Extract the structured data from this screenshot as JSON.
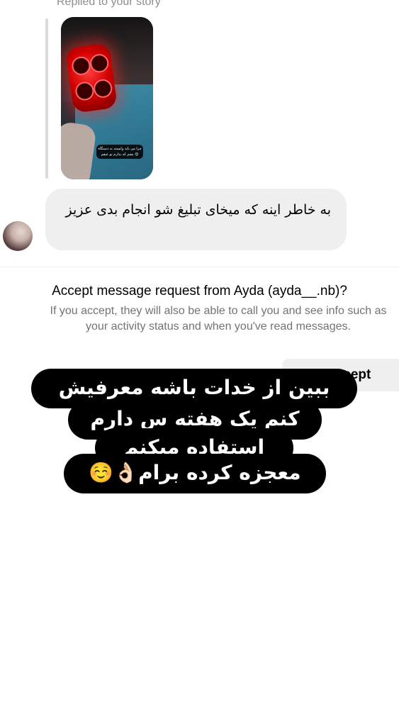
{
  "thread": {
    "replied_label": "Replied to your story",
    "story": {
      "caption": "چرا من باید وابسته به دستگاه بشم که بذارم تو عیفم 😊"
    },
    "message": "به خاطر اینه که میخای تبلیغ شو انجام بدی عزیز"
  },
  "request": {
    "title": "Accept message request from Ayda (ayda__.nb)?",
    "body_line1": "If you accept, they will also be able to call you and see info such as",
    "body_line2": "your activity status and when you've read messages.",
    "accept_label": "Accept"
  },
  "overlay": {
    "lines": [
      "ببین از خدات باشه معرفیش",
      "کنم یک هفته س دارم",
      "استفاده میکنم",
      "معجزه کرده برام👌🏻☺️"
    ]
  },
  "colors": {
    "bubble_bg": "#efeff0",
    "secondary_text": "#737373",
    "overlay_bg": "#000000",
    "overlay_text": "#ffffff"
  }
}
